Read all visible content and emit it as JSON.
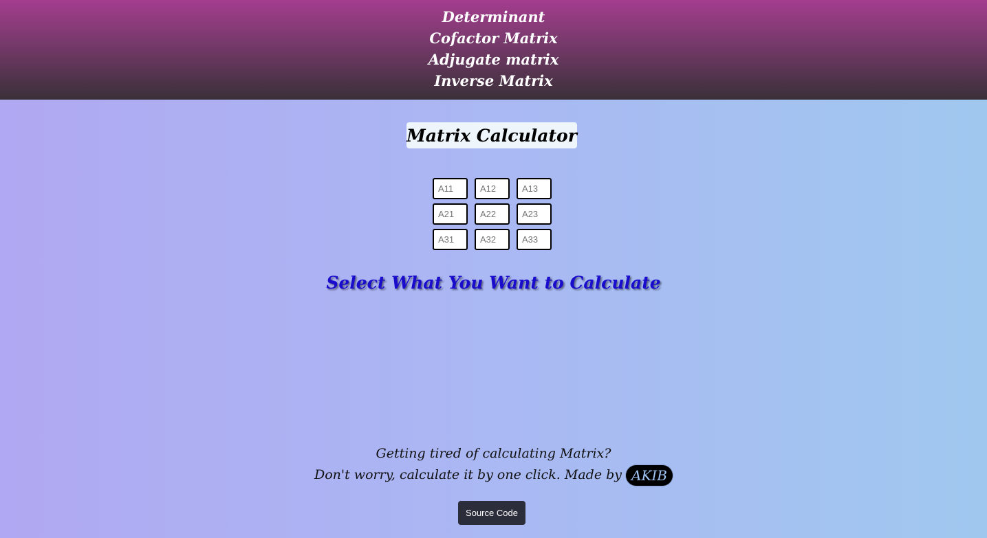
{
  "nav": {
    "items": [
      {
        "label": "Determinant"
      },
      {
        "label": "Cofactor Matrix"
      },
      {
        "label": "Adjugate matrix"
      },
      {
        "label": "Inverse Matrix"
      }
    ]
  },
  "main": {
    "title": "Matrix Calculator",
    "matrix": {
      "placeholders": [
        [
          "A11",
          "A12",
          "A13"
        ],
        [
          "A21",
          "A22",
          "A23"
        ],
        [
          "A31",
          "A32",
          "A33"
        ]
      ]
    },
    "select_prompt": "Select What You Want to Calculate"
  },
  "footer": {
    "line1": "Getting tired of calculating Matrix?",
    "line2": "Don't worry, calculate it by one click.  Made by",
    "author_badge": "AKIB",
    "source_button": "Source Code"
  },
  "colors": {
    "nav_gradient_top": "#a43d8e",
    "nav_gradient_bottom": "#3a3038",
    "heading_blue": "#1a0ccc",
    "button_dark": "#2c2d3b"
  }
}
